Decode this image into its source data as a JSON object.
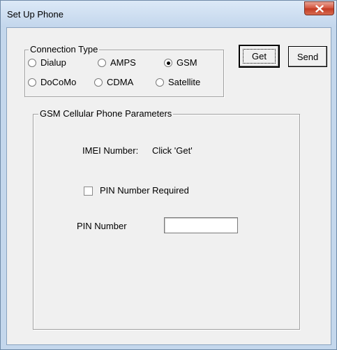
{
  "window": {
    "title": "Set Up Phone"
  },
  "connection_type": {
    "legend": "Connection Type",
    "options": [
      {
        "label": "Dialup",
        "selected": false
      },
      {
        "label": "AMPS",
        "selected": false
      },
      {
        "label": "GSM",
        "selected": true
      },
      {
        "label": "DoCoMo",
        "selected": false
      },
      {
        "label": "CDMA",
        "selected": false
      },
      {
        "label": "Satellite",
        "selected": false
      }
    ]
  },
  "buttons": {
    "get_label": "Get",
    "send_label": "Send"
  },
  "parameters": {
    "legend": "GSM Cellular Phone Parameters",
    "imei_label": "IMEI Number:",
    "imei_value": "Click 'Get'",
    "pin_required_label": "PIN Number Required",
    "pin_required_checked": false,
    "pin_label": "PIN Number",
    "pin_value": ""
  },
  "colors": {
    "dialog_background": "#f0f0f0",
    "window_frame": "#c4d7ec",
    "close_button": "#c9462d"
  }
}
